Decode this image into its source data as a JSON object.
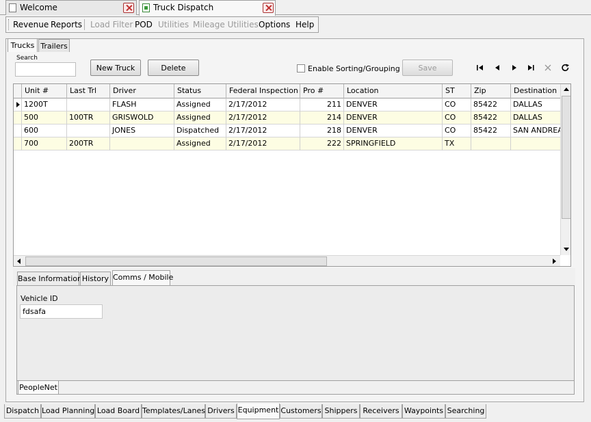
{
  "doc_tabs": [
    {
      "label": "Welcome"
    },
    {
      "label": "Truck Dispatch"
    }
  ],
  "menu": {
    "items": [
      {
        "label": "Revenue",
        "enabled": true
      },
      {
        "label": "Reports",
        "enabled": true
      },
      {
        "label": "Load Filter",
        "enabled": false
      },
      {
        "label": "POD",
        "enabled": true
      },
      {
        "label": "Utilities",
        "enabled": false
      },
      {
        "label": "Mileage Utilities",
        "enabled": false
      },
      {
        "label": "Options",
        "enabled": true
      },
      {
        "label": "Help",
        "enabled": true
      }
    ]
  },
  "panel_tabs": [
    {
      "label": "Trucks",
      "active": true
    },
    {
      "label": "Trailers",
      "active": false
    }
  ],
  "toolbar": {
    "search_label": "Search",
    "search_value": "",
    "new_truck": "New Truck",
    "delete": "Delete",
    "enable_sorting": "Enable Sorting/Grouping",
    "enable_sorting_checked": false,
    "save": "Save",
    "nav_icons": [
      "first-record-icon",
      "prev-record-icon",
      "next-record-icon",
      "last-record-icon",
      "cancel-edit-icon",
      "refresh-icon"
    ]
  },
  "grid": {
    "columns": [
      "Unit #",
      "Last Trl",
      "Driver",
      "Status",
      "Federal Inspection",
      "Pro #",
      "Location",
      "ST",
      "Zip",
      "Destination"
    ],
    "rows": [
      {
        "unit": "1200T",
        "last_trl": "",
        "driver": "FLASH",
        "status": "Assigned",
        "fed_insp": "2/17/2012",
        "pro": "211",
        "location": "DENVER",
        "st": "CO",
        "zip": "85422",
        "destination": "DALLAS",
        "selected": true
      },
      {
        "unit": "500",
        "last_trl": "100TR",
        "driver": "GRISWOLD",
        "status": "Assigned",
        "fed_insp": "2/17/2012",
        "pro": "214",
        "location": "DENVER",
        "st": "CO",
        "zip": "85422",
        "destination": "DALLAS",
        "selected": false
      },
      {
        "unit": "600",
        "last_trl": "",
        "driver": "JONES",
        "status": "Dispatched",
        "fed_insp": "2/17/2012",
        "pro": "218",
        "location": "DENVER",
        "st": "CO",
        "zip": "85422",
        "destination": "SAN ANDREAS",
        "selected": false
      },
      {
        "unit": "700",
        "last_trl": "200TR",
        "driver": "",
        "status": "Assigned",
        "fed_insp": "2/17/2012",
        "pro": "222",
        "location": "SPRINGFIELD",
        "st": "TX",
        "zip": "",
        "destination": "",
        "selected": false
      }
    ]
  },
  "detail_tabs": [
    {
      "label": "Base Information",
      "active": false
    },
    {
      "label": "History",
      "active": false
    },
    {
      "label": "Comms / Mobile",
      "active": true
    }
  ],
  "detail": {
    "vehicle_id_label": "Vehicle ID",
    "vehicle_id_value": "fdsafa",
    "sub_tab": "PeopleNet"
  },
  "bottom_tabs": [
    {
      "label": "Dispatch",
      "active": false
    },
    {
      "label": "Load Planning",
      "active": false
    },
    {
      "label": "Load Board",
      "active": false
    },
    {
      "label": "Templates/Lanes",
      "active": false
    },
    {
      "label": "Drivers",
      "active": false
    },
    {
      "label": "Equipment",
      "active": true
    },
    {
      "label": "Customers",
      "active": false
    },
    {
      "label": "Shippers",
      "active": false
    },
    {
      "label": "Receivers",
      "active": false
    },
    {
      "label": "Waypoints",
      "active": false
    },
    {
      "label": "Searching",
      "active": false
    }
  ],
  "colors": {
    "alt_row": "#fdfde3",
    "close_red": "#c03030",
    "disabled_text": "#9a9a9a"
  }
}
